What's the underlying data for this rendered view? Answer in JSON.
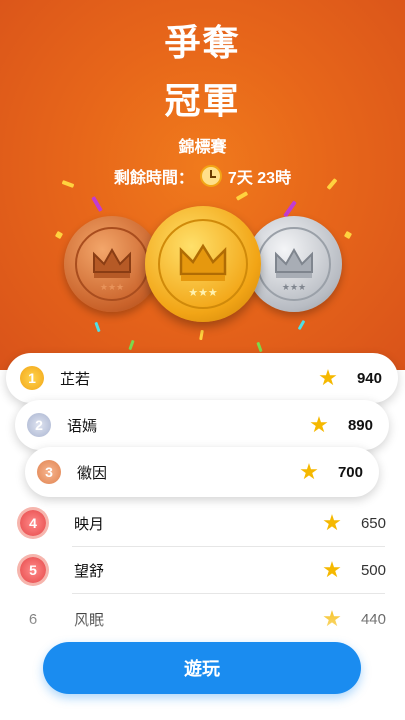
{
  "header": {
    "title_line1": "爭奪",
    "title_line2": "冠軍",
    "subtitle": "錦標賽",
    "timer_label": "剩餘時間：",
    "timer_value": "7天 23時"
  },
  "leaderboard": [
    {
      "rank": "1",
      "name": "芷若",
      "score": "940"
    },
    {
      "rank": "2",
      "name": "语嫣",
      "score": "890"
    },
    {
      "rank": "3",
      "name": "徽因",
      "score": "700"
    },
    {
      "rank": "4",
      "name": "映月",
      "score": "650"
    },
    {
      "rank": "5",
      "name": "望舒",
      "score": "500"
    },
    {
      "rank": "6",
      "name": "风眠",
      "score": "440"
    }
  ],
  "play_button": {
    "label": "遊玩"
  },
  "icons": {
    "star": "star-icon",
    "clock": "clock-icon",
    "crown": "crown-icon"
  },
  "colors": {
    "hero_orange": "#e7661a",
    "gold": "#f2b21a",
    "silver": "#c9cdd3",
    "bronze": "#d87a3a",
    "button_blue": "#1a8cf0",
    "star_yellow": "#f5b800"
  }
}
